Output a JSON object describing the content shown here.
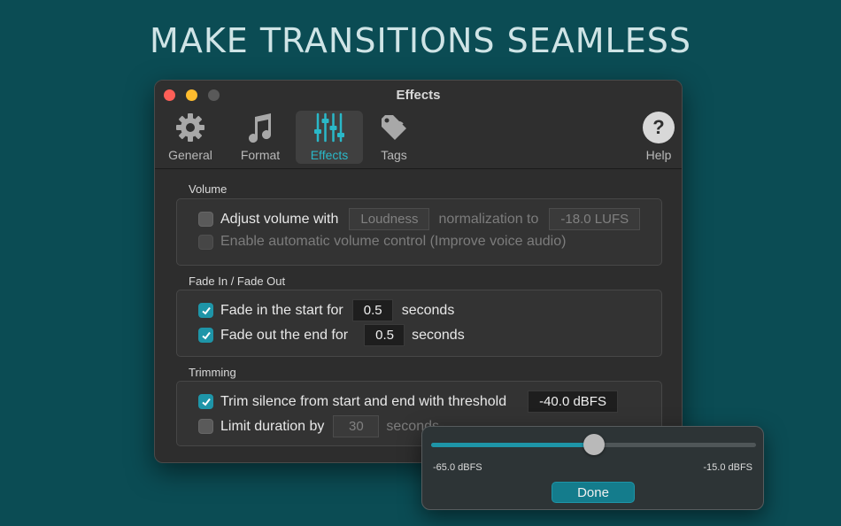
{
  "headline": "MAKE TRANSITIONS SEAMLESS",
  "window": {
    "title": "Effects"
  },
  "toolbar": {
    "tabs": [
      {
        "label": "General",
        "icon": "gear-icon"
      },
      {
        "label": "Format",
        "icon": "music-note-icon"
      },
      {
        "label": "Effects",
        "icon": "sliders-icon",
        "active": true
      },
      {
        "label": "Tags",
        "icon": "tag-icon"
      }
    ],
    "help_label": "Help",
    "help_glyph": "?"
  },
  "volume": {
    "title": "Volume",
    "adjust_label": "Adjust volume with",
    "adjust_checked": false,
    "mode_value": "Loudness",
    "normalization_label": "normalization to",
    "target_value": "-18.0 LUFS",
    "auto_label": "Enable automatic volume control (Improve voice audio)",
    "auto_checked": false
  },
  "fade": {
    "title": "Fade In / Fade Out",
    "fade_in_label": "Fade in the start for",
    "fade_in_checked": true,
    "fade_in_value": "0.5",
    "fade_in_unit": "seconds",
    "fade_out_label": "Fade out the end for",
    "fade_out_checked": true,
    "fade_out_value": "0.5",
    "fade_out_unit": "seconds"
  },
  "trimming": {
    "title": "Trimming",
    "trim_label": "Trim silence from start and end with threshold",
    "trim_checked": true,
    "threshold_value": "-40.0 dBFS",
    "limit_label": "Limit duration by",
    "limit_checked": false,
    "limit_value": "30",
    "limit_unit": "seconds"
  },
  "popover": {
    "min_label": "-65.0 dBFS",
    "max_label": "-15.0 dBFS",
    "slider_fraction": 0.5,
    "done_label": "Done"
  },
  "colors": {
    "accent": "#1e95a8",
    "background": "#0b4c54"
  }
}
